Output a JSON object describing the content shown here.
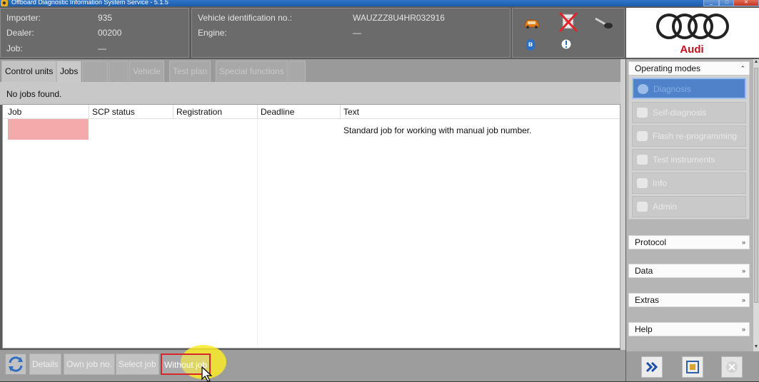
{
  "window": {
    "title": "Offboard Diagnostic Information System Service - 5.1.5",
    "controls": [
      "minimize",
      "maximize",
      "close"
    ]
  },
  "header": {
    "importer_label": "Importer:",
    "importer_value": "935",
    "dealer_label": "Dealer:",
    "dealer_value": "00200",
    "job_label": "Job:",
    "job_value": "—",
    "vin_label": "Vehicle identification no.:",
    "vin_value": "WAUZZZ8U4HR032916",
    "engine_label": "Engine:",
    "engine_value": "—",
    "status_icons": [
      "car-icon",
      "vehicle-data-blocked-icon",
      "key-icon",
      "bluetooth-icon",
      "info-warning-icon"
    ]
  },
  "logo": {
    "brand": "Audi"
  },
  "tabs": [
    {
      "label": "Control units",
      "active": false
    },
    {
      "label": "Jobs",
      "active": true
    },
    {
      "label": "",
      "active": false
    },
    {
      "label": "",
      "active": false
    },
    {
      "label": "Vehicle",
      "active": false
    },
    {
      "label": "Test plan",
      "active": false
    },
    {
      "label": "Special functions",
      "active": false
    },
    {
      "label": "",
      "active": false
    }
  ],
  "main": {
    "status_text": "No jobs found.",
    "columns": [
      "Job",
      "SCP status",
      "Registration",
      "Deadline",
      "Text"
    ],
    "rows": [
      {
        "job": "",
        "scp_status": "",
        "registration": "",
        "deadline": "",
        "text": "Standard job for working with manual job number."
      }
    ]
  },
  "bottom_toolbar": {
    "refresh_icon": "refresh-icon",
    "details": "Details",
    "own_job": "Own job no.",
    "select_job": "Select job",
    "without_job": "Without job"
  },
  "sidebar": {
    "operating_modes": {
      "title": "Operating modes",
      "items": [
        {
          "label": "Diagnosis",
          "icon": "stethoscope-icon",
          "active": true
        },
        {
          "label": "Self-diagnosis",
          "icon": "hand-icon",
          "active": false
        },
        {
          "label": "Flash re-programming",
          "icon": "flash-icon",
          "active": false
        },
        {
          "label": "Test instruments",
          "icon": "gauge-icon",
          "active": false
        },
        {
          "label": "Info",
          "icon": "info-icon",
          "active": false
        },
        {
          "label": "Admin",
          "icon": "admin-icon",
          "active": false
        }
      ]
    },
    "protocol": "Protocol",
    "data": "Data",
    "extras": "Extras",
    "help": "Help"
  },
  "colors": {
    "accent_blue": "#4f82c9",
    "selected_row": "#f4aaaa",
    "highlight_red": "#d9262c",
    "cursor_halo": "#faeb28",
    "brand_red": "#c0121e"
  }
}
